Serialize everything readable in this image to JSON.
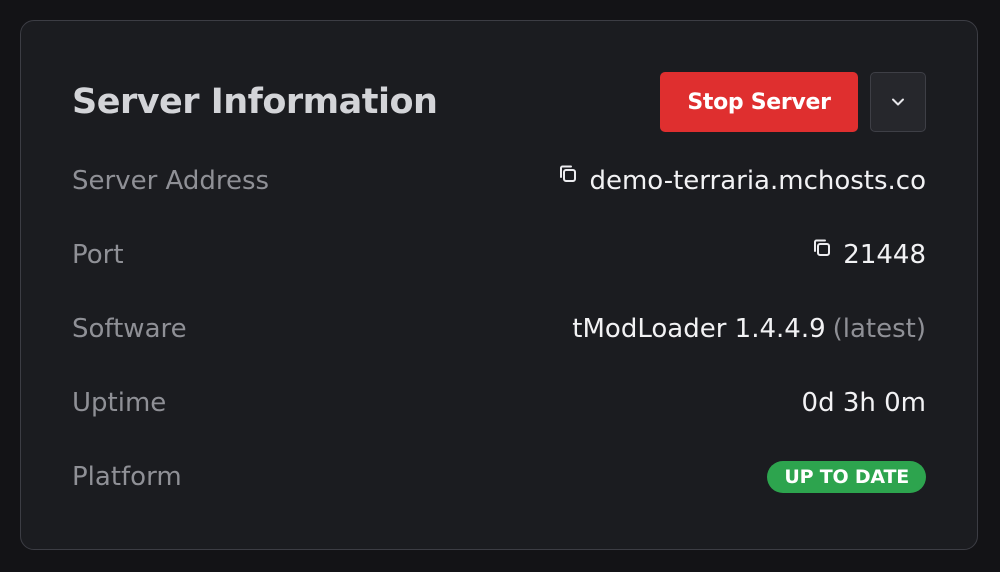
{
  "card": {
    "title": "Server Information"
  },
  "actions": {
    "stop_label": "Stop Server",
    "menu_icon": "chevron-down-icon"
  },
  "rows": {
    "address": {
      "label": "Server Address",
      "value": "demo-terraria.mchosts.co",
      "icon": "copy-icon"
    },
    "port": {
      "label": "Port",
      "value": "21448",
      "icon": "copy-icon"
    },
    "software": {
      "label": "Software",
      "value": "tModLoader 1.4.4.9",
      "suffix": "(latest)"
    },
    "uptime": {
      "label": "Uptime",
      "value": "0d 3h 0m"
    },
    "platform": {
      "label": "Platform",
      "badge": "UP TO DATE"
    }
  },
  "colors": {
    "background": "#131316",
    "card": "#1b1c20",
    "danger": "#df2f2f",
    "success": "#2da44e",
    "label": "#8f9096",
    "value": "#f2f2f4"
  }
}
